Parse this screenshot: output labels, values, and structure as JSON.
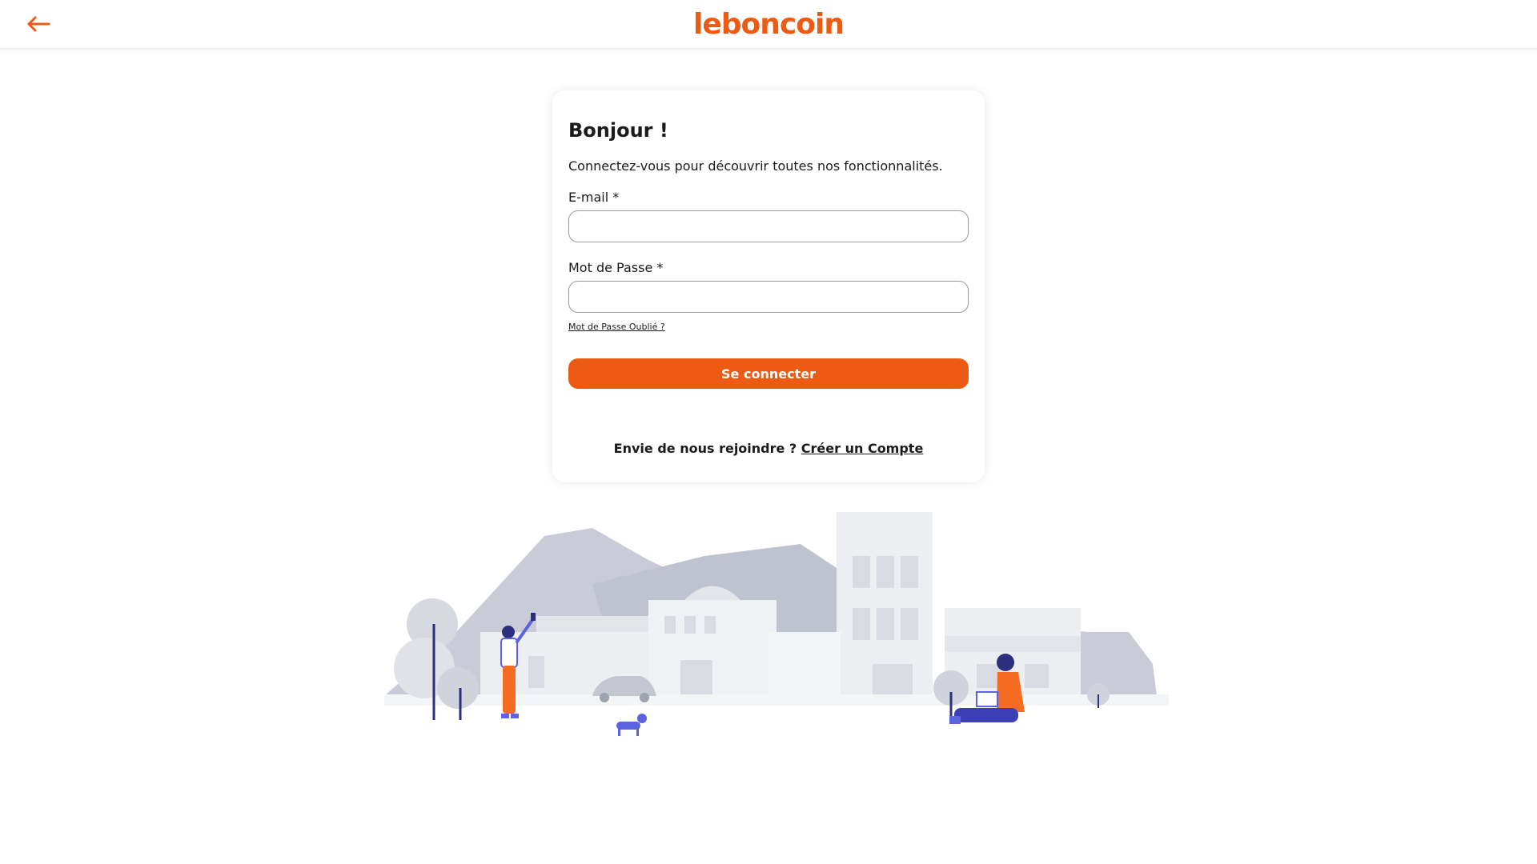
{
  "header": {
    "back_icon": "arrow-left-icon",
    "logo_text": "leboncoin",
    "brand_color": "#ec5a13"
  },
  "login": {
    "title": "Bonjour !",
    "subtitle": "Connectez-vous pour découvrir toutes nos fonctionnalités.",
    "email_label": "E-mail *",
    "email_value": "",
    "password_label": "Mot de Passe *",
    "password_value": "",
    "forgot_link": "Mot de Passe Oublié ?",
    "submit_label": "Se connecter",
    "join_text": "Envie de nous rejoindre ?",
    "create_account_link": "Créer un Compte"
  },
  "illustration": {
    "name": "town-scene-illustration"
  }
}
